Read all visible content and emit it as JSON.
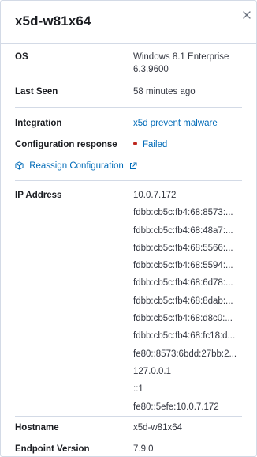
{
  "flyout": {
    "title": "x5d-w81x64",
    "close_icon": "close-icon"
  },
  "details": {
    "os": {
      "label": "OS",
      "value_line1": "Windows 8.1 Enterprise",
      "value_line2": "6.3.9600"
    },
    "last_seen": {
      "label": "Last Seen",
      "value": "58 minutes ago"
    },
    "integration": {
      "label": "Integration",
      "value": "x5d prevent malware"
    },
    "configuration_response": {
      "label": "Configuration response",
      "value": "Failed",
      "status_color": "#bd271e"
    },
    "reassign": {
      "label": "Reassign Configuration",
      "icon": "package-icon",
      "trailing_icon": "external-link-icon"
    },
    "ip_address": {
      "label": "IP Address",
      "values": [
        "10.0.7.172",
        "fdbb:cb5c:fb4:68:8573:...",
        "fdbb:cb5c:fb4:68:48a7:...",
        "fdbb:cb5c:fb4:68:5566:...",
        "fdbb:cb5c:fb4:68:5594:...",
        "fdbb:cb5c:fb4:68:6d78:...",
        "fdbb:cb5c:fb4:68:8dab:...",
        "fdbb:cb5c:fb4:68:d8c0:...",
        "fdbb:cb5c:fb4:68:fc18:d...",
        "fe80::8573:6bdd:27bb:2...",
        "127.0.0.1",
        "::1",
        "fe80::5efe:10.0.7.172"
      ]
    },
    "hostname": {
      "label": "Hostname",
      "value": "x5d-w81x64"
    },
    "endpoint_version": {
      "label": "Endpoint Version",
      "value": "7.9.0"
    }
  },
  "colors": {
    "link": "#006bb8",
    "failed": "#bd271e",
    "border": "#d3dae6",
    "text": "#343741",
    "heading": "#1a1c21"
  }
}
